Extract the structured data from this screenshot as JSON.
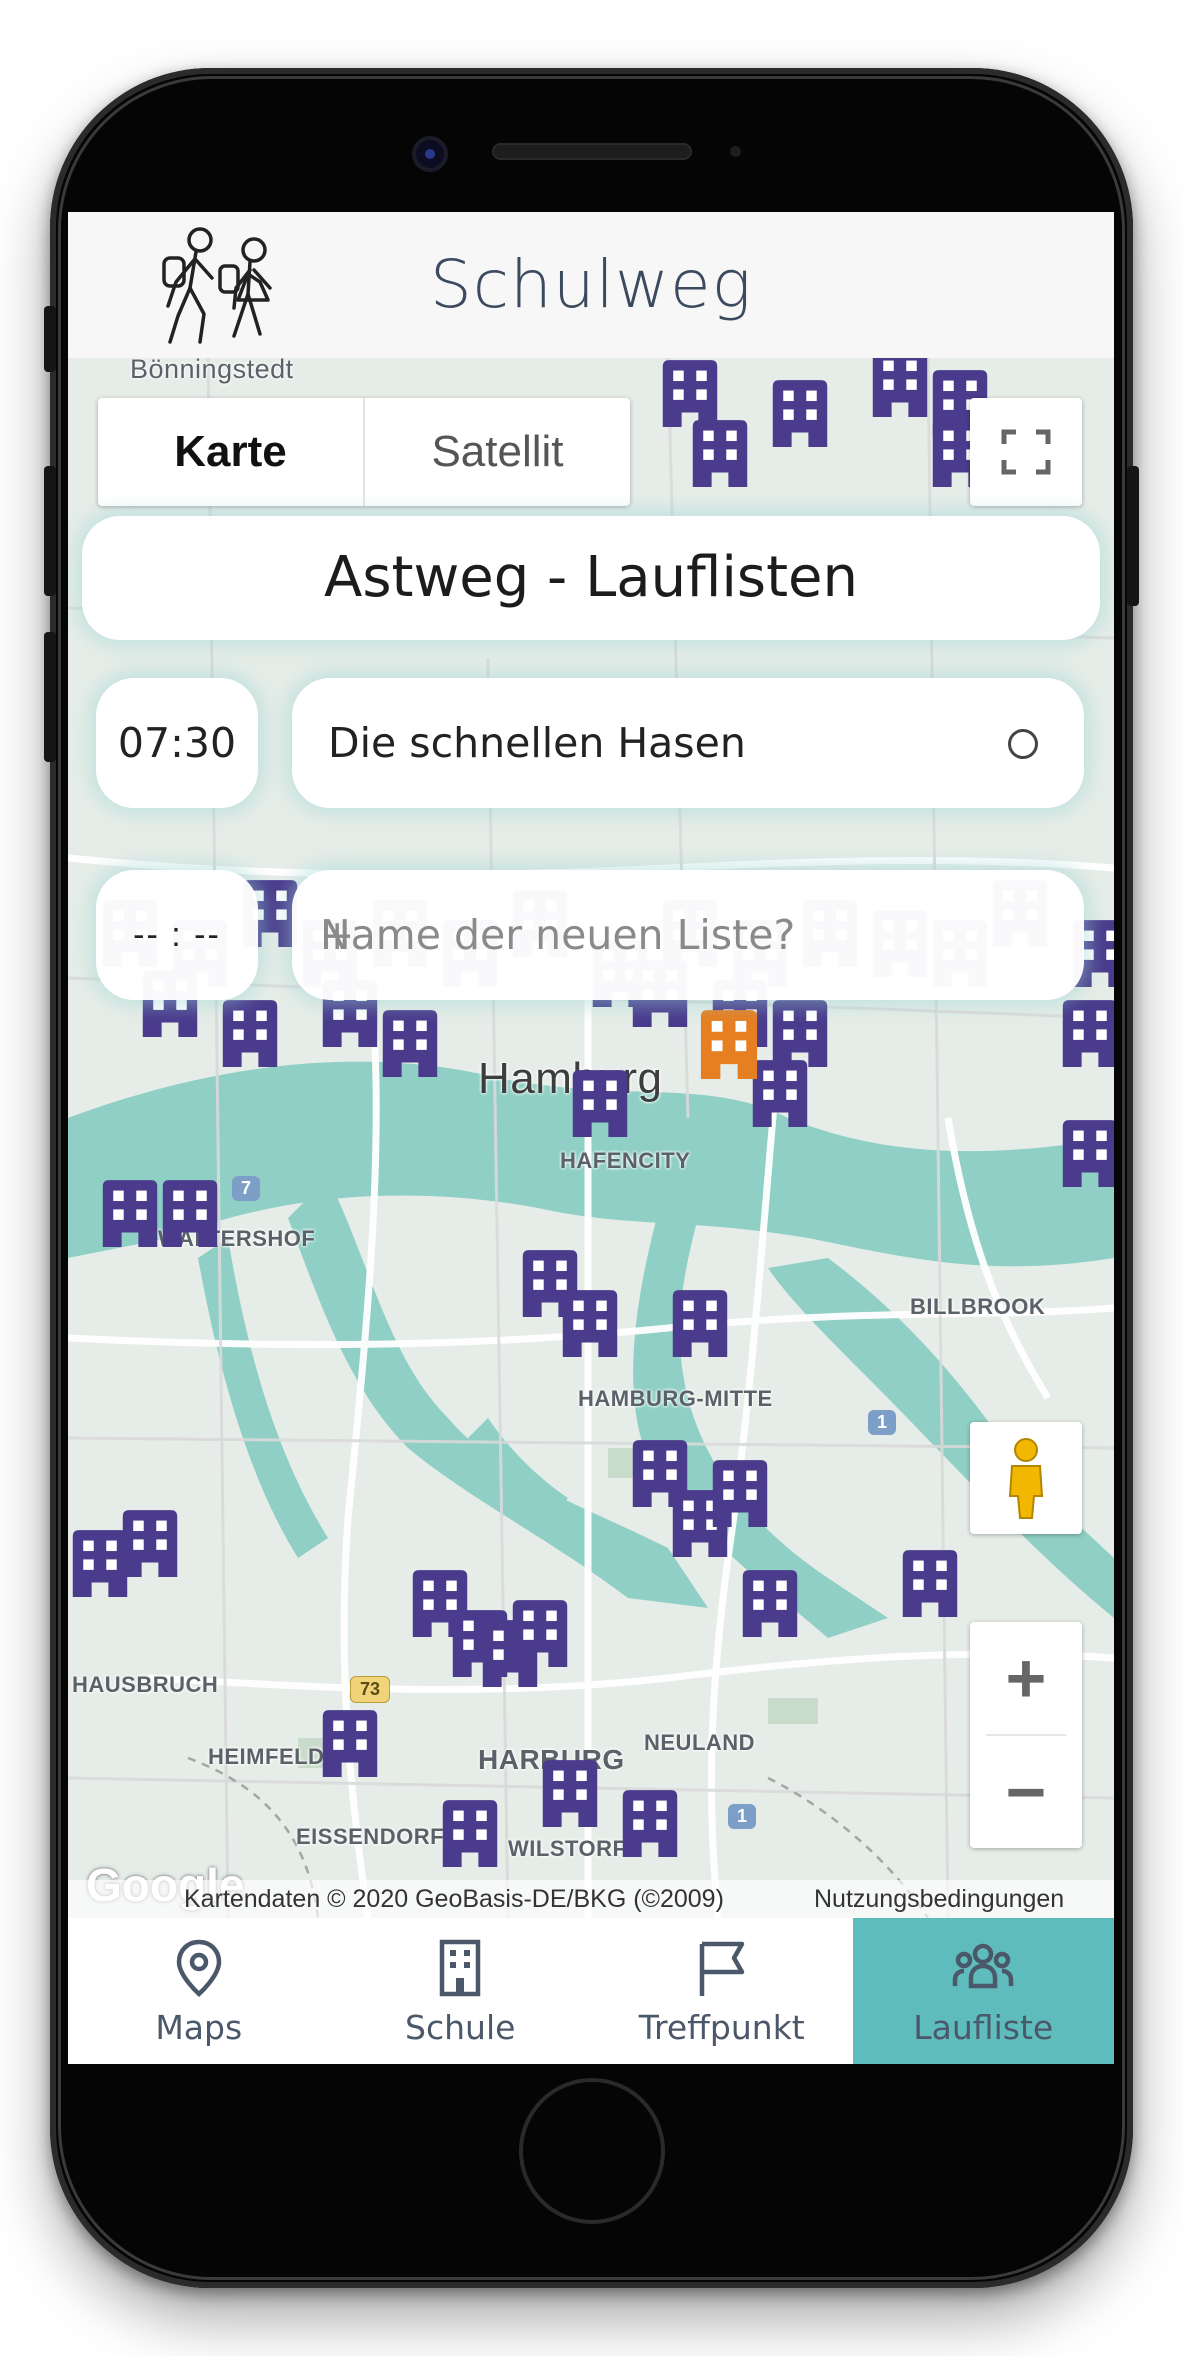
{
  "app": {
    "title": "Schulweg"
  },
  "map_controls": {
    "type_options": [
      "Karte",
      "Satellit"
    ],
    "selected_type": "Karte",
    "zoom_in": "+",
    "zoom_out": "−"
  },
  "map": {
    "labels": [
      "Bönningstedt",
      "Hamburg",
      "HAFENCITY",
      "WALTERSHOF",
      "BILLBROOK",
      "HAMBURG-MITTE",
      "HAUSBRUCH",
      "HEIMFELD",
      "HARBURG",
      "NEULAND",
      "EISSENDORF",
      "WILSTORF"
    ],
    "route_badges": [
      "7",
      "1",
      "73",
      "1"
    ],
    "google": "Google",
    "attribution": "Kartendaten © 2020 GeoBasis-DE/BKG (©2009)",
    "terms": "Nutzungsbedingungen",
    "marker_color": "#4a3b8c",
    "selected_marker_color": "#e67e22"
  },
  "panel": {
    "title": "Astweg - Lauflisten",
    "lists": [
      {
        "time": "07:30",
        "name": "Die schnellen Hasen"
      }
    ],
    "new_time": "-- : --",
    "new_name_placeholder": "Name der neuen Liste?",
    "add_symbol": "+"
  },
  "nav": {
    "items": [
      {
        "label": "Maps",
        "icon": "map-pin-icon"
      },
      {
        "label": "Schule",
        "icon": "school-building-icon"
      },
      {
        "label": "Treffpunkt",
        "icon": "flag-icon"
      },
      {
        "label": "Laufliste",
        "icon": "group-icon"
      }
    ],
    "active": "Laufliste",
    "accent": "#5fbcbc"
  }
}
